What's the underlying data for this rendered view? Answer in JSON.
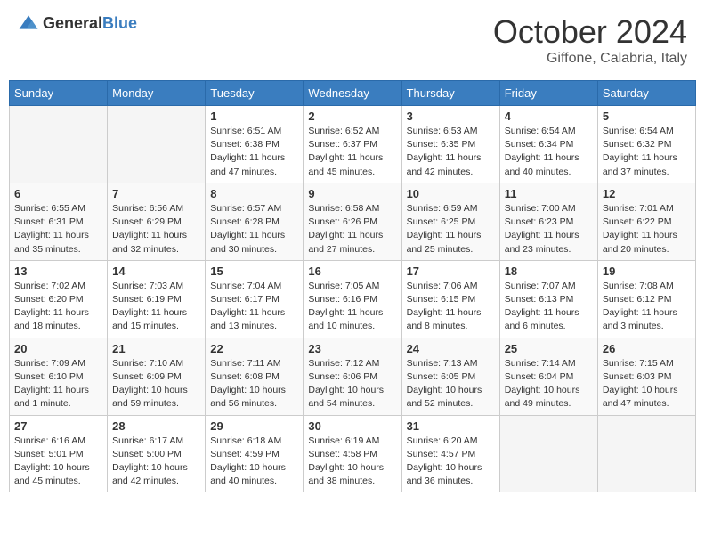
{
  "header": {
    "logo": {
      "general": "General",
      "blue": "Blue"
    },
    "title": "October 2024",
    "location": "Giffone, Calabria, Italy"
  },
  "days_of_week": [
    "Sunday",
    "Monday",
    "Tuesday",
    "Wednesday",
    "Thursday",
    "Friday",
    "Saturday"
  ],
  "weeks": [
    [
      {
        "day": "",
        "info": ""
      },
      {
        "day": "",
        "info": ""
      },
      {
        "day": "1",
        "info": "Sunrise: 6:51 AM\nSunset: 6:38 PM\nDaylight: 11 hours and 47 minutes."
      },
      {
        "day": "2",
        "info": "Sunrise: 6:52 AM\nSunset: 6:37 PM\nDaylight: 11 hours and 45 minutes."
      },
      {
        "day": "3",
        "info": "Sunrise: 6:53 AM\nSunset: 6:35 PM\nDaylight: 11 hours and 42 minutes."
      },
      {
        "day": "4",
        "info": "Sunrise: 6:54 AM\nSunset: 6:34 PM\nDaylight: 11 hours and 40 minutes."
      },
      {
        "day": "5",
        "info": "Sunrise: 6:54 AM\nSunset: 6:32 PM\nDaylight: 11 hours and 37 minutes."
      }
    ],
    [
      {
        "day": "6",
        "info": "Sunrise: 6:55 AM\nSunset: 6:31 PM\nDaylight: 11 hours and 35 minutes."
      },
      {
        "day": "7",
        "info": "Sunrise: 6:56 AM\nSunset: 6:29 PM\nDaylight: 11 hours and 32 minutes."
      },
      {
        "day": "8",
        "info": "Sunrise: 6:57 AM\nSunset: 6:28 PM\nDaylight: 11 hours and 30 minutes."
      },
      {
        "day": "9",
        "info": "Sunrise: 6:58 AM\nSunset: 6:26 PM\nDaylight: 11 hours and 27 minutes."
      },
      {
        "day": "10",
        "info": "Sunrise: 6:59 AM\nSunset: 6:25 PM\nDaylight: 11 hours and 25 minutes."
      },
      {
        "day": "11",
        "info": "Sunrise: 7:00 AM\nSunset: 6:23 PM\nDaylight: 11 hours and 23 minutes."
      },
      {
        "day": "12",
        "info": "Sunrise: 7:01 AM\nSunset: 6:22 PM\nDaylight: 11 hours and 20 minutes."
      }
    ],
    [
      {
        "day": "13",
        "info": "Sunrise: 7:02 AM\nSunset: 6:20 PM\nDaylight: 11 hours and 18 minutes."
      },
      {
        "day": "14",
        "info": "Sunrise: 7:03 AM\nSunset: 6:19 PM\nDaylight: 11 hours and 15 minutes."
      },
      {
        "day": "15",
        "info": "Sunrise: 7:04 AM\nSunset: 6:17 PM\nDaylight: 11 hours and 13 minutes."
      },
      {
        "day": "16",
        "info": "Sunrise: 7:05 AM\nSunset: 6:16 PM\nDaylight: 11 hours and 10 minutes."
      },
      {
        "day": "17",
        "info": "Sunrise: 7:06 AM\nSunset: 6:15 PM\nDaylight: 11 hours and 8 minutes."
      },
      {
        "day": "18",
        "info": "Sunrise: 7:07 AM\nSunset: 6:13 PM\nDaylight: 11 hours and 6 minutes."
      },
      {
        "day": "19",
        "info": "Sunrise: 7:08 AM\nSunset: 6:12 PM\nDaylight: 11 hours and 3 minutes."
      }
    ],
    [
      {
        "day": "20",
        "info": "Sunrise: 7:09 AM\nSunset: 6:10 PM\nDaylight: 11 hours and 1 minute."
      },
      {
        "day": "21",
        "info": "Sunrise: 7:10 AM\nSunset: 6:09 PM\nDaylight: 10 hours and 59 minutes."
      },
      {
        "day": "22",
        "info": "Sunrise: 7:11 AM\nSunset: 6:08 PM\nDaylight: 10 hours and 56 minutes."
      },
      {
        "day": "23",
        "info": "Sunrise: 7:12 AM\nSunset: 6:06 PM\nDaylight: 10 hours and 54 minutes."
      },
      {
        "day": "24",
        "info": "Sunrise: 7:13 AM\nSunset: 6:05 PM\nDaylight: 10 hours and 52 minutes."
      },
      {
        "day": "25",
        "info": "Sunrise: 7:14 AM\nSunset: 6:04 PM\nDaylight: 10 hours and 49 minutes."
      },
      {
        "day": "26",
        "info": "Sunrise: 7:15 AM\nSunset: 6:03 PM\nDaylight: 10 hours and 47 minutes."
      }
    ],
    [
      {
        "day": "27",
        "info": "Sunrise: 6:16 AM\nSunset: 5:01 PM\nDaylight: 10 hours and 45 minutes."
      },
      {
        "day": "28",
        "info": "Sunrise: 6:17 AM\nSunset: 5:00 PM\nDaylight: 10 hours and 42 minutes."
      },
      {
        "day": "29",
        "info": "Sunrise: 6:18 AM\nSunset: 4:59 PM\nDaylight: 10 hours and 40 minutes."
      },
      {
        "day": "30",
        "info": "Sunrise: 6:19 AM\nSunset: 4:58 PM\nDaylight: 10 hours and 38 minutes."
      },
      {
        "day": "31",
        "info": "Sunrise: 6:20 AM\nSunset: 4:57 PM\nDaylight: 10 hours and 36 minutes."
      },
      {
        "day": "",
        "info": ""
      },
      {
        "day": "",
        "info": ""
      }
    ]
  ]
}
